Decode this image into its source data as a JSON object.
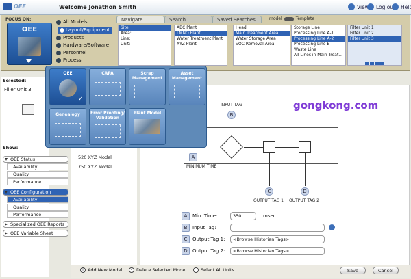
{
  "header": {
    "logo_text": "OEE",
    "welcome": "Welcome Jonathon Smith",
    "view": "View",
    "logout": "Log out",
    "help": "Help"
  },
  "focus": {
    "label": "FOCUS ON:",
    "title": "OEE",
    "models": [
      "All Models",
      "Layout/Equipment",
      "Products",
      "Hardware/Software",
      "Personnel",
      "Process"
    ]
  },
  "tabs": [
    "Navigate",
    "Search",
    "Saved Searches"
  ],
  "toggle": {
    "left": "model",
    "right": "Template"
  },
  "nav": {
    "col1": [
      "Site:",
      "Area:",
      "Line:",
      "Unit:"
    ],
    "col2": [
      "ABC Plant",
      "LMNO Plant",
      "Water Treatment Plant",
      "XYZ Plant"
    ],
    "col3": [
      "Head",
      "Main Treatment Area",
      "Water Storage Area",
      "VOC Removal Area"
    ],
    "col4": [
      "Storage Line",
      "Processing Line A-1",
      "Processing Line A-2",
      "Processing Line B",
      "Waste Line",
      "All Lines in Main Treat..."
    ],
    "col5": [
      "Filter Unit 1",
      "Filter Unit 2",
      "Filter Unit 3"
    ]
  },
  "left": {
    "selected_label": "Selected:",
    "selected_value": "Filler Unit 3",
    "show_label": "Show:",
    "tree": [
      {
        "label": "OEE Status",
        "open": true,
        "children": [
          "Availability",
          "Quality",
          "Performance"
        ]
      },
      {
        "label": "OEE Configuration",
        "open": true,
        "children": [
          "Availability",
          "Quality",
          "Performance"
        ]
      },
      {
        "label": "Specialized OEE Reports",
        "open": false,
        "children": []
      },
      {
        "label": "OEE Variable Sheet",
        "open": false,
        "children": []
      }
    ]
  },
  "middle": {
    "items": [
      "520 XYZ Model",
      "750 XYZ Model"
    ]
  },
  "popup": {
    "tiles": [
      "OEE",
      "CAPA",
      "Scrap Management",
      "Asset Management",
      "Genealogy",
      "Error Proofing/ Validation",
      "Plant Model"
    ]
  },
  "diagram": {
    "input_tag": "INPUT TAG",
    "min_time": "MINIMUM TIME",
    "out1": "OUTPUT TAG 1",
    "out2": "OUTPUT TAG 2",
    "letters": [
      "A",
      "B",
      "C",
      "D"
    ]
  },
  "form": {
    "min_time_label": "Min. Time:",
    "min_time_value": "350",
    "min_time_unit": "msec",
    "input_tag_label": "Input Tag:",
    "input_tag_value": "",
    "out1_label": "Output Tag 1:",
    "out1_value": "<Browse  Historian Tags>",
    "out2_label": "Output Tag 2:",
    "out2_value": "<Browse  Historian Tags>"
  },
  "bottom": {
    "add": "Add New Model",
    "delete": "Delete Selected Model",
    "select_all": "Select All Units",
    "save": "Save",
    "cancel": "Cancel"
  },
  "watermark": "gongkong.com",
  "colors": {
    "accent": "#2f63b4",
    "watermark": "#7f3bd6",
    "focus_bg": "#d4ccaa"
  }
}
